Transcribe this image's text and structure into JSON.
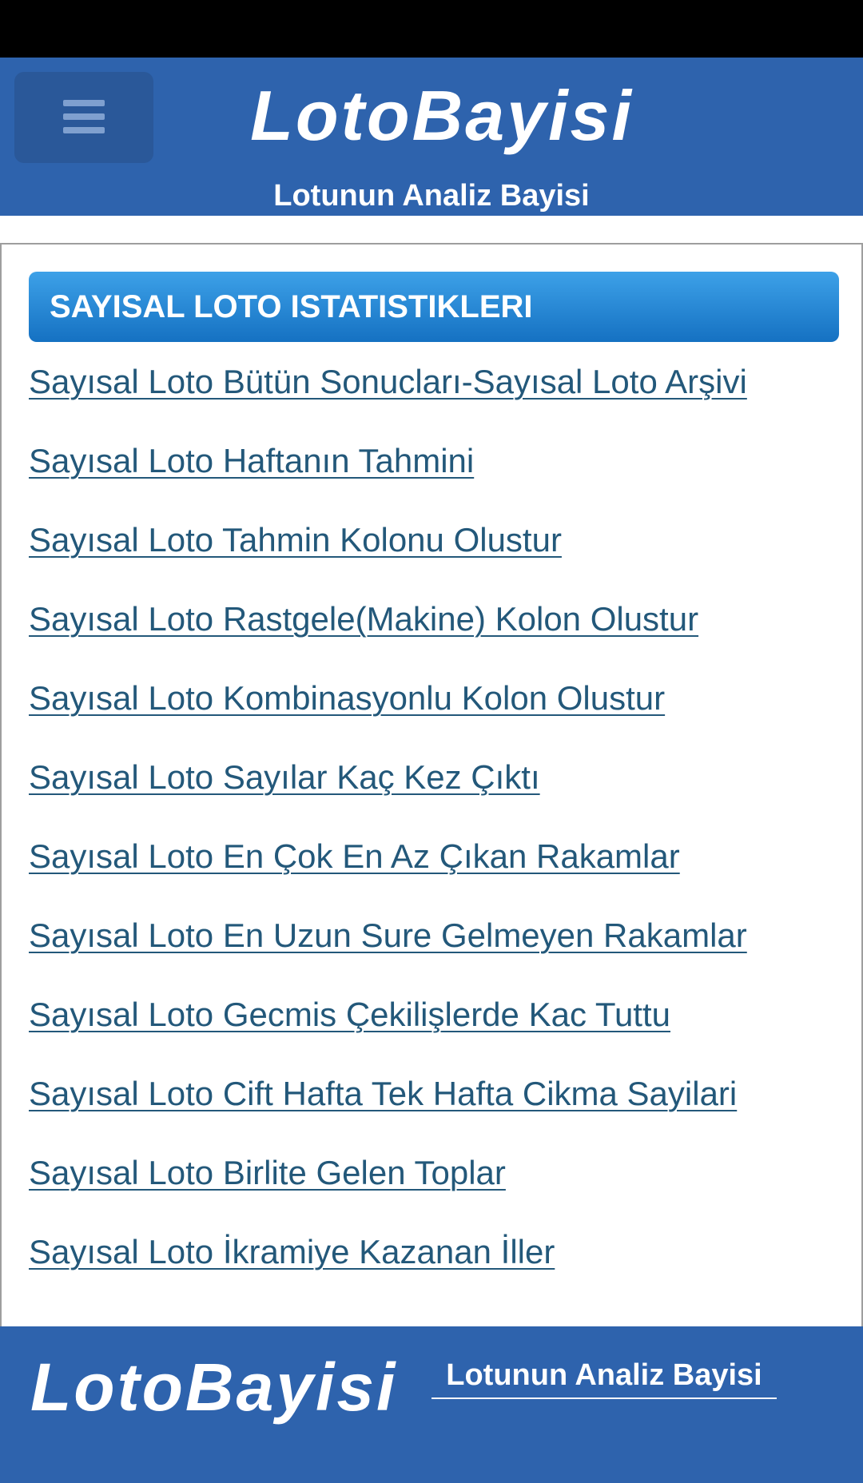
{
  "header": {
    "menu_icon": "hamburger-menu-icon",
    "title": "LotoBayisi",
    "subtitle": "Lotunun Analiz Bayisi"
  },
  "section": {
    "title": "SAYISAL LOTO ISTATISTIKLERI",
    "links": [
      "Sayısal Loto Bütün Sonucları-Sayısal Loto Arşivi",
      "Sayısal Loto Haftanın Tahmini",
      "Sayısal Loto Tahmin Kolonu Olustur",
      "Sayısal Loto Rastgele(Makine) Kolon Olustur",
      "Sayısal Loto Kombinasyonlu Kolon Olustur",
      "Sayısal Loto Sayılar Kaç Kez Çıktı",
      "Sayısal Loto En Çok En Az Çıkan Rakamlar",
      "Sayısal Loto En Uzun Sure Gelmeyen Rakamlar",
      "Sayısal Loto Gecmis Çekilişlerde Kac Tuttu",
      "Sayısal Loto Cift Hafta Tek Hafta Cikma Sayilari",
      "Sayısal Loto Birlite Gelen Toplar",
      "Sayısal Loto İkramiye Kazanan İller"
    ]
  },
  "footer": {
    "logo": "LotoBayisi",
    "tagline": "Lotunun Analiz Bayisi"
  },
  "colors": {
    "header_bg": "#2e63ad",
    "section_header_top": "#3da1e8",
    "section_header_bottom": "#1571c2",
    "link": "#23587a"
  }
}
